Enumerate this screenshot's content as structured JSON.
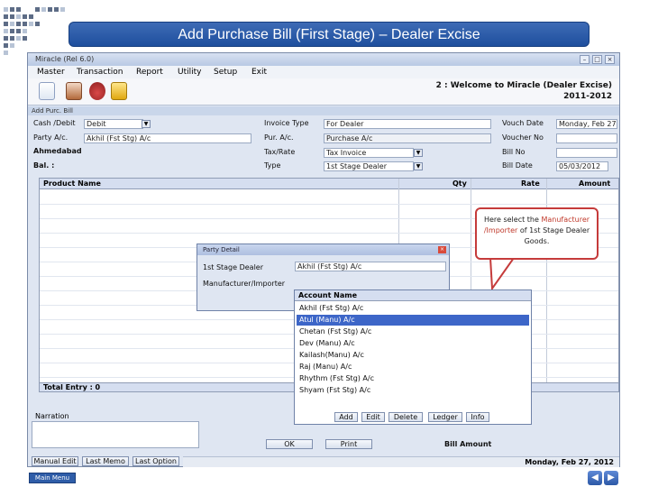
{
  "slide": {
    "title": "Add Purchase Bill (First Stage) – Dealer Excise",
    "main_menu_label": "Main Menu",
    "prev_icon": "left-arrow-icon",
    "next_icon": "right-arrow-icon",
    "accent": "#2a5aa8"
  },
  "window": {
    "title": "Miracle (Rel 6.0)",
    "menu": [
      "Master",
      "Transaction",
      "Report",
      "Utility",
      "Setup",
      "Exit"
    ],
    "welcome_line1": "2 : Welcome to Miracle (Dealer Excise)",
    "welcome_line2": "2011-2012",
    "subwindow_title": "Add Purc. Bill",
    "status_text": "Monday, Feb 27, 2012"
  },
  "toolbar": {
    "icons": [
      "copy-icon",
      "cart-icon",
      "money-bag-icon",
      "edit-icon"
    ]
  },
  "form": {
    "cash_debit_label": "Cash /Debit",
    "cash_debit_value": "Debit",
    "party_label": "Party A/c.",
    "party_value": "Akhil (Fst Stg) A/c",
    "invoice_type_label": "Invoice Type",
    "invoice_type_value": "For Dealer",
    "pur_ac_label": "Pur. A/c.",
    "pur_ac_value": "Purchase A/c",
    "tax_rate_label": "Tax/Rate",
    "tax_rate_value": "Tax Invoice",
    "type_label": "Type",
    "type_value": "1st Stage Dealer",
    "ahmedabad_label": "Ahmedabad",
    "bal_label": "Bal. :",
    "vouch_date_label": "Vouch Date",
    "vouch_date_value": "Monday, Feb 27, 2012",
    "vouch_no_label": "Voucher No",
    "bill_no_label": "Bill No",
    "bill_date_label": "Bill Date",
    "bill_date_value": "05/03/2012"
  },
  "grid": {
    "columns": [
      "Product Name",
      "Qty",
      "Rate",
      "Amount"
    ],
    "total_label": "Total Entry : 0"
  },
  "footer": {
    "narration_label": "Narration",
    "ok_label": "OK",
    "print_label": "Print",
    "bill_amount_label": "Bill Amount",
    "bottom_buttons": [
      "Manual Edit",
      "Last Memo",
      "Last Option"
    ]
  },
  "party_dialog": {
    "title": "Party Detail",
    "first_stage_label": "1st Stage Dealer",
    "first_stage_value": "Akhil (Fst Stg) A/c",
    "manufacturer_label": "Manufacturer/Importer"
  },
  "account_list": {
    "header": "Account Name",
    "items": [
      "Akhil (Fst Stg) A/c",
      "Atul (Manu) A/c",
      "Chetan (Fst Stg) A/c",
      "Dev (Manu) A/c",
      "Kailash(Manu) A/c",
      "Raj (Manu) A/c",
      "Rhythm (Fst Stg) A/c",
      "Shyam (Fst Stg) A/c"
    ],
    "selected_index": 1,
    "buttons": [
      "Add",
      "Edit",
      "Delete",
      "Ledger",
      "Info"
    ]
  },
  "callout": {
    "text_pre": "Here select the ",
    "text_hl": "Manufacturer /Importer",
    "text_post": " of 1st Stage Dealer Goods."
  }
}
